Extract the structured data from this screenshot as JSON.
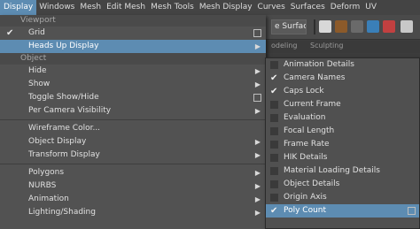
{
  "menubar": {
    "items": [
      "Display",
      "Windows",
      "Mesh",
      "Edit Mesh",
      "Mesh Tools",
      "Mesh Display",
      "Curves",
      "Surfaces",
      "Deform",
      "UV"
    ],
    "active_index": 0
  },
  "toolbar": {
    "surface_button_label": "e Surface",
    "shelf_tabs": [
      "odeling",
      "Sculpting"
    ]
  },
  "display_menu": {
    "viewport_section": "Viewport",
    "grid_label": "Grid",
    "heads_up_label": "Heads Up Display",
    "object_section": "Object",
    "hide_label": "Hide",
    "show_label": "Show",
    "toggle_show_hide_label": "Toggle Show/Hide",
    "per_camera_visibility_label": "Per Camera Visibility",
    "wireframe_color_label": "Wireframe Color...",
    "object_display_label": "Object Display",
    "transform_display_label": "Transform Display",
    "polygons_label": "Polygons",
    "nurbs_label": "NURBS",
    "animation_label": "Animation",
    "lighting_shading_label": "Lighting/Shading"
  },
  "hud_menu": {
    "items": [
      {
        "label": "Animation Details",
        "checked": false
      },
      {
        "label": "Camera Names",
        "checked": true
      },
      {
        "label": "Caps Lock",
        "checked": true
      },
      {
        "label": "Current Frame",
        "checked": false
      },
      {
        "label": "Evaluation",
        "checked": false
      },
      {
        "label": "Focal Length",
        "checked": false
      },
      {
        "label": "Frame Rate",
        "checked": false
      },
      {
        "label": "HIK Details",
        "checked": false
      },
      {
        "label": "Material Loading Details",
        "checked": false
      },
      {
        "label": "Object Details",
        "checked": false
      },
      {
        "label": "Origin Axis",
        "checked": false
      },
      {
        "label": "Poly Count",
        "checked": true
      }
    ],
    "highlighted_index": 11
  },
  "glyphs": {
    "check": "✔",
    "arrow": "▶"
  },
  "colors": {
    "highlight": "#5d8cb2",
    "menu_bg": "#525252"
  }
}
